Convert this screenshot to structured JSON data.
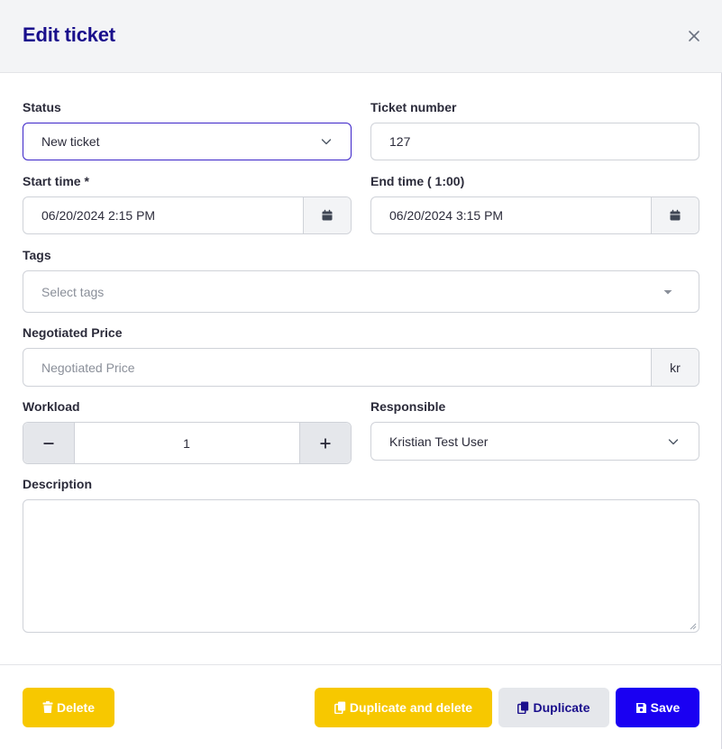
{
  "modal": {
    "title": "Edit ticket"
  },
  "form": {
    "status": {
      "label": "Status",
      "value": "New ticket"
    },
    "ticket_number": {
      "label": "Ticket number",
      "value": "127"
    },
    "start_time": {
      "label": "Start time *",
      "value": "06/20/2024 2:15 PM"
    },
    "end_time": {
      "label": "End time ( 1:00)",
      "value": "06/20/2024 3:15 PM"
    },
    "tags": {
      "label": "Tags",
      "placeholder": "Select tags"
    },
    "negotiated_price": {
      "label": "Negotiated Price",
      "placeholder": "Negotiated Price",
      "currency": "kr"
    },
    "workload": {
      "label": "Workload",
      "value": "1",
      "minus": "−",
      "plus": "+"
    },
    "responsible": {
      "label": "Responsible",
      "value": "Kristian Test User"
    },
    "description": {
      "label": "Description",
      "value": ""
    }
  },
  "footer": {
    "delete_label": "Delete",
    "duplicate_delete_label": "Duplicate and delete",
    "duplicate_label": "Duplicate",
    "save_label": "Save"
  },
  "icons": {
    "close": "close-icon",
    "chevron": "chevron-down-icon",
    "caret": "caret-down-icon",
    "calendar": "calendar-icon",
    "trash": "trash-icon",
    "copy": "copy-icon",
    "floppy": "floppy-disk-icon"
  },
  "colors": {
    "title": "#1a0f8c",
    "focus_border": "#3b23c8",
    "yellow": "#f7c800",
    "blue": "#1a00f2",
    "gray": "#e5e7eb"
  }
}
